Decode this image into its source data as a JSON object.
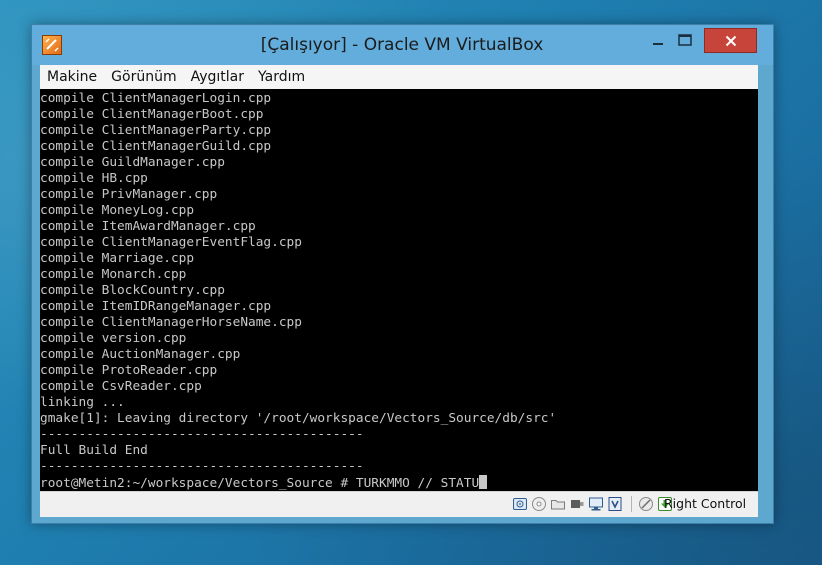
{
  "window": {
    "title": "[Çalışıyor] - Oracle VM VirtualBox"
  },
  "menu": {
    "items": [
      "Makine",
      "Görünüm",
      "Aygıtlar",
      "Yardım"
    ]
  },
  "console": {
    "lines": [
      "compile ClientManagerLogin.cpp",
      "compile ClientManagerBoot.cpp",
      "compile ClientManagerParty.cpp",
      "compile ClientManagerGuild.cpp",
      "compile GuildManager.cpp",
      "compile HB.cpp",
      "compile PrivManager.cpp",
      "compile MoneyLog.cpp",
      "compile ItemAwardManager.cpp",
      "compile ClientManagerEventFlag.cpp",
      "compile Marriage.cpp",
      "compile Monarch.cpp",
      "compile BlockCountry.cpp",
      "compile ItemIDRangeManager.cpp",
      "compile ClientManagerHorseName.cpp",
      "compile version.cpp",
      "compile AuctionManager.cpp",
      "compile ProtoReader.cpp",
      "compile CsvReader.cpp",
      "linking ...",
      "gmake[1]: Leaving directory '/root/workspace/Vectors_Source/db/src'",
      "------------------------------------------",
      "Full Build End",
      "------------------------------------------"
    ],
    "prompt": "root@Metin2:~/workspace/Vectors_Source # TURKMMO // STATU"
  },
  "statusbar": {
    "icons": [
      "hard-disk-icon",
      "optical-drive-icon",
      "shared-folders-icon",
      "usb-icon",
      "network-icon",
      "virtualization-icon",
      "mouse-integration-icon",
      "host-key-icon"
    ],
    "host_key_label": "Right Control"
  },
  "colors": {
    "desktop": "#1f7fb0",
    "window_frame": "#62addb",
    "close_button": "#c7443a",
    "console_bg": "#000000",
    "console_text": "#c8c8c8"
  }
}
